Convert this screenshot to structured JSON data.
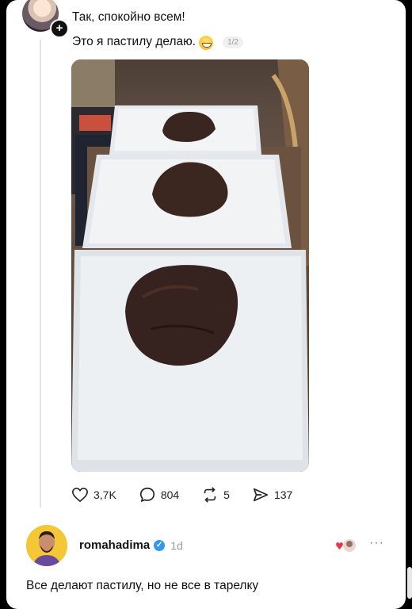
{
  "post": {
    "line1": "Так, спокойно всем!",
    "line2": "Это я пастилу делаю.",
    "emoji": "grinning-face-sweat",
    "pager": "1/2"
  },
  "actions": {
    "likes": "3,7K",
    "comments": "804",
    "reposts": "5",
    "shares": "137"
  },
  "reply": {
    "username": "romahadima",
    "time": "1d",
    "text": "Все делают пастилу, но не все в тарелку",
    "more": "···"
  },
  "colors": {
    "verified": "#3797f0",
    "avatar_bg": "#f3c736"
  }
}
